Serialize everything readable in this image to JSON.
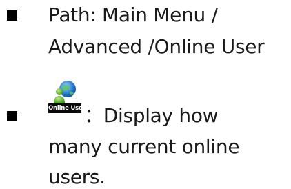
{
  "items": [
    {
      "lines": [
        "Path: Main Menu /",
        "Advanced /Online User"
      ]
    },
    {
      "icon": {
        "name": "online-user-icon",
        "caption": "Online User"
      },
      "text_after_icon": "：Display how",
      "lines": [
        "many current online",
        "users."
      ]
    }
  ],
  "colors": {
    "bullet": "#000000",
    "text": "#1a1a1a",
    "icon_caption_bg": "#0a0a0a",
    "icon_globe": "#2f86d8",
    "icon_person": "#4caf2f"
  }
}
